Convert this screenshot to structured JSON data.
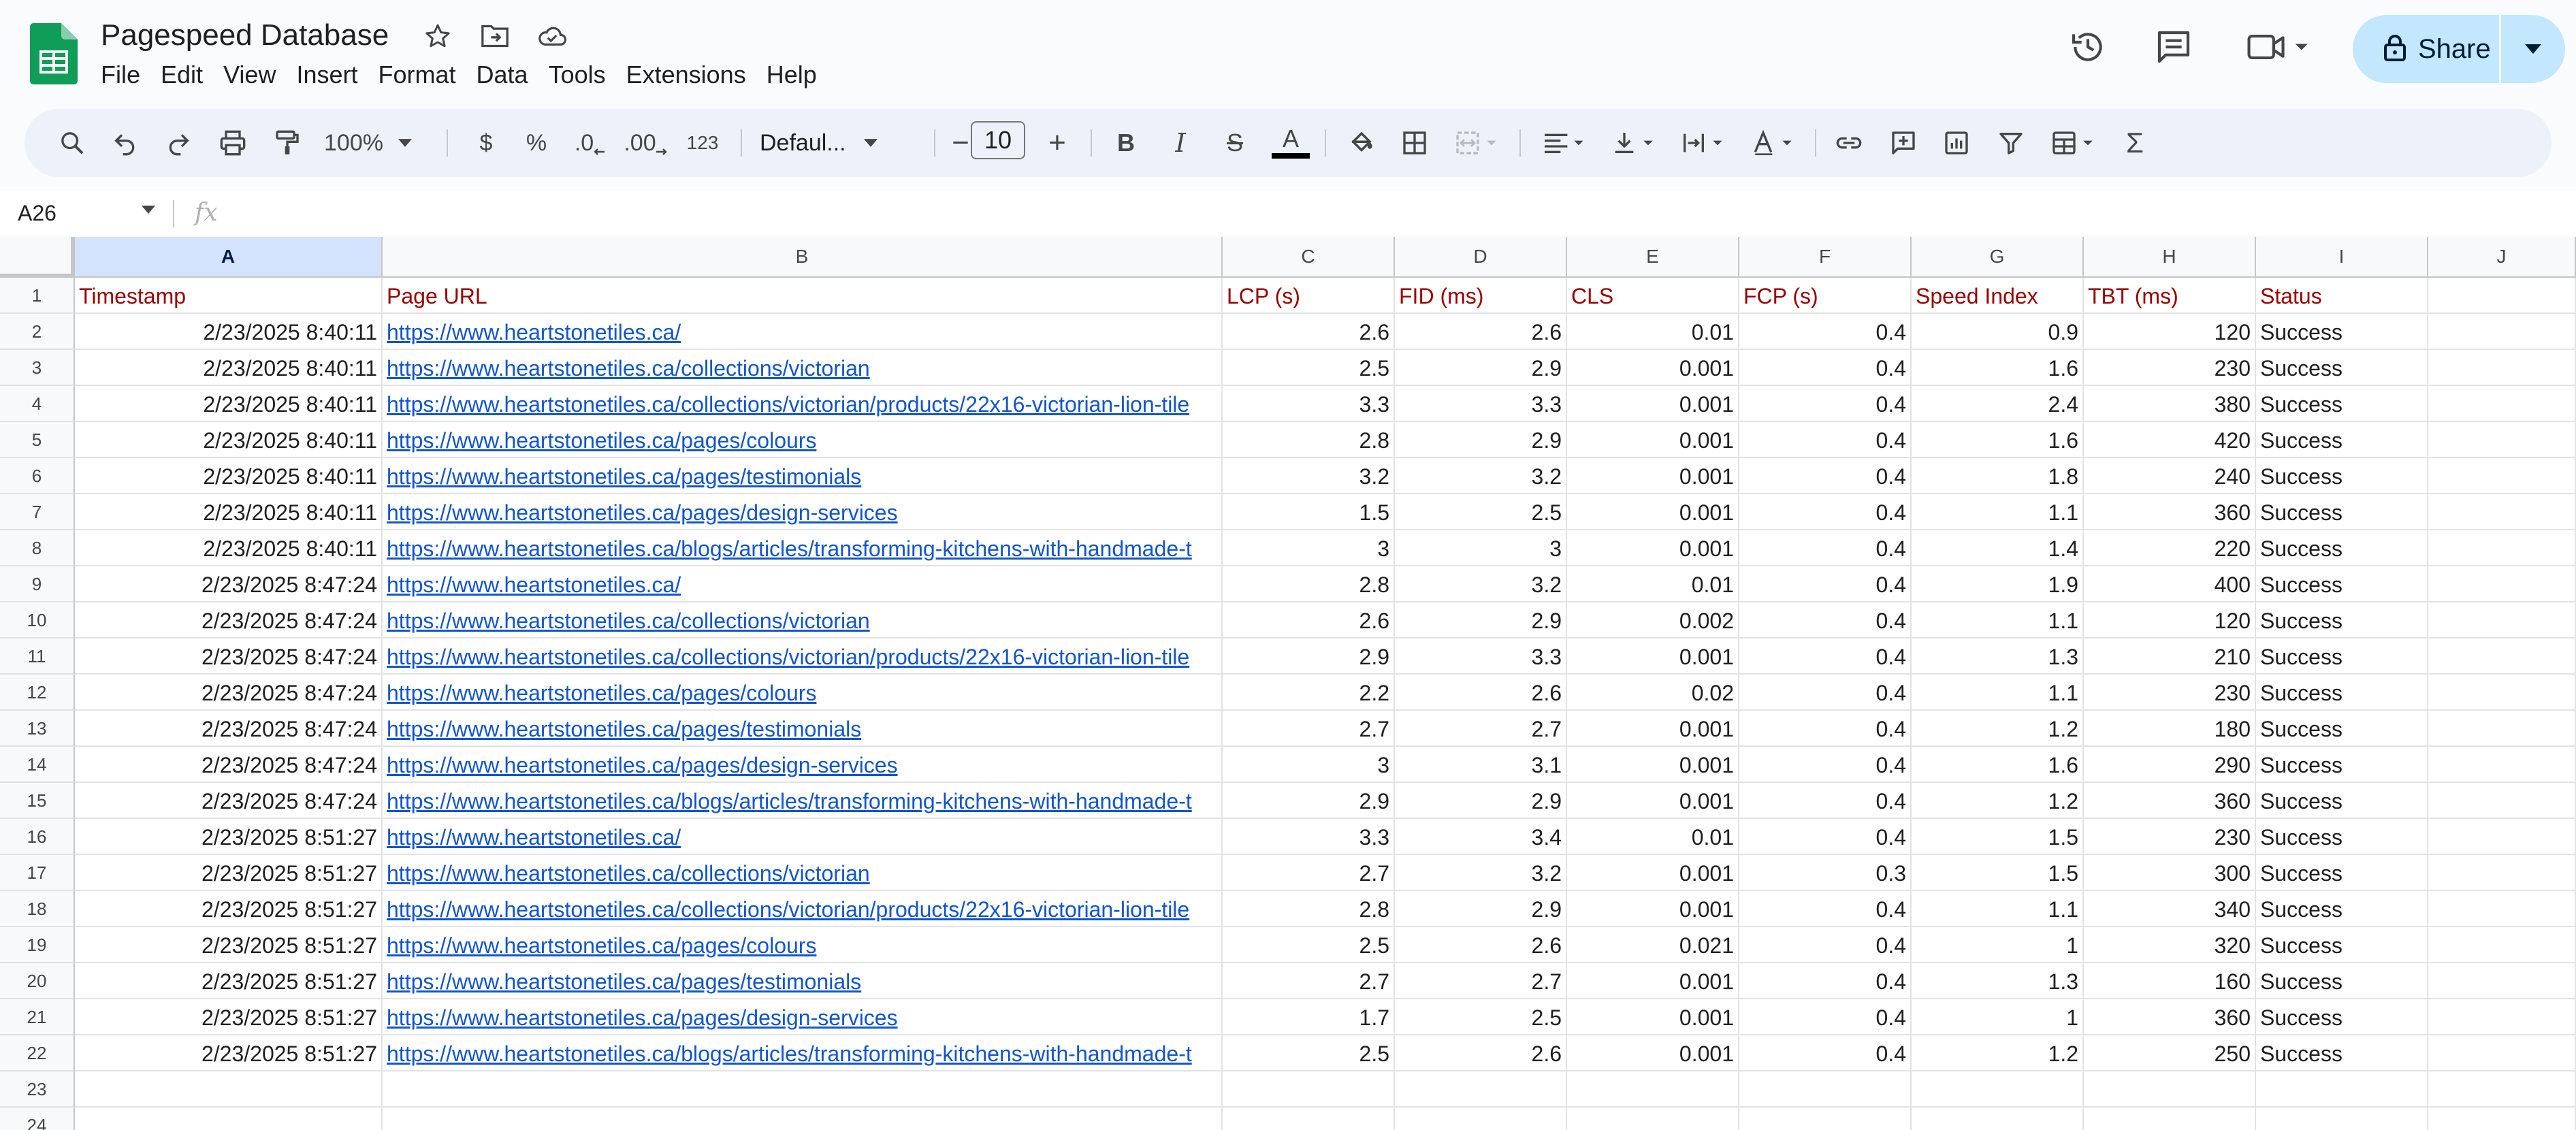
{
  "app": {
    "title": "Pagespeed Database",
    "menu": [
      "File",
      "Edit",
      "View",
      "Insert",
      "Format",
      "Data",
      "Tools",
      "Extensions",
      "Help"
    ],
    "share_label": "Share",
    "accent": "#c2e7ff"
  },
  "toolbar": {
    "zoom": "100%",
    "currency": "$",
    "percent": "%",
    "dec_decrease": ".0",
    "dec_increase": ".00",
    "number_format": "123",
    "font": "Defaul...",
    "font_size": "10",
    "minus": "−",
    "plus": "+",
    "bold": "B",
    "italic": "I",
    "strike": "S",
    "text_color": "A",
    "text_color_swatch": "#000000",
    "function": "Σ"
  },
  "formula_bar": {
    "cell_ref": "A26",
    "fx": "fx"
  },
  "columns": [
    "A",
    "B",
    "C",
    "D",
    "E",
    "F",
    "G",
    "H",
    "I",
    "J"
  ],
  "selected_column": "A",
  "row_numbers": [
    "1",
    "2",
    "3",
    "4",
    "5",
    "6",
    "7",
    "8",
    "9",
    "10",
    "11",
    "12",
    "13",
    "14",
    "15",
    "16",
    "17",
    "18",
    "19",
    "20",
    "21",
    "22",
    "23",
    "24"
  ],
  "sheet": {
    "headers": [
      "Timestamp",
      "Page URL",
      "LCP (s)",
      "FID (ms)",
      "CLS",
      "FCP (s)",
      "Speed Index",
      "TBT (ms)",
      "Status"
    ],
    "header_color": "#980000",
    "link_color": "#1155cc",
    "rows": [
      [
        "2/23/2025 8:40:11",
        "https://www.heartstonetiles.ca/",
        "2.6",
        "2.6",
        "0.01",
        "0.4",
        "0.9",
        "120",
        "Success"
      ],
      [
        "2/23/2025 8:40:11",
        "https://www.heartstonetiles.ca/collections/victorian",
        "2.5",
        "2.9",
        "0.001",
        "0.4",
        "1.6",
        "230",
        "Success"
      ],
      [
        "2/23/2025 8:40:11",
        "https://www.heartstonetiles.ca/collections/victorian/products/22x16-victorian-lion-tile",
        "3.3",
        "3.3",
        "0.001",
        "0.4",
        "2.4",
        "380",
        "Success"
      ],
      [
        "2/23/2025 8:40:11",
        "https://www.heartstonetiles.ca/pages/colours",
        "2.8",
        "2.9",
        "0.001",
        "0.4",
        "1.6",
        "420",
        "Success"
      ],
      [
        "2/23/2025 8:40:11",
        "https://www.heartstonetiles.ca/pages/testimonials",
        "3.2",
        "3.2",
        "0.001",
        "0.4",
        "1.8",
        "240",
        "Success"
      ],
      [
        "2/23/2025 8:40:11",
        "https://www.heartstonetiles.ca/pages/design-services",
        "1.5",
        "2.5",
        "0.001",
        "0.4",
        "1.1",
        "360",
        "Success"
      ],
      [
        "2/23/2025 8:40:11",
        "https://www.heartstonetiles.ca/blogs/articles/transforming-kitchens-with-handmade-t",
        "3",
        "3",
        "0.001",
        "0.4",
        "1.4",
        "220",
        "Success"
      ],
      [
        "2/23/2025 8:47:24",
        "https://www.heartstonetiles.ca/",
        "2.8",
        "3.2",
        "0.01",
        "0.4",
        "1.9",
        "400",
        "Success"
      ],
      [
        "2/23/2025 8:47:24",
        "https://www.heartstonetiles.ca/collections/victorian",
        "2.6",
        "2.9",
        "0.002",
        "0.4",
        "1.1",
        "120",
        "Success"
      ],
      [
        "2/23/2025 8:47:24",
        "https://www.heartstonetiles.ca/collections/victorian/products/22x16-victorian-lion-tile",
        "2.9",
        "3.3",
        "0.001",
        "0.4",
        "1.3",
        "210",
        "Success"
      ],
      [
        "2/23/2025 8:47:24",
        "https://www.heartstonetiles.ca/pages/colours",
        "2.2",
        "2.6",
        "0.02",
        "0.4",
        "1.1",
        "230",
        "Success"
      ],
      [
        "2/23/2025 8:47:24",
        "https://www.heartstonetiles.ca/pages/testimonials",
        "2.7",
        "2.7",
        "0.001",
        "0.4",
        "1.2",
        "180",
        "Success"
      ],
      [
        "2/23/2025 8:47:24",
        "https://www.heartstonetiles.ca/pages/design-services",
        "3",
        "3.1",
        "0.001",
        "0.4",
        "1.6",
        "290",
        "Success"
      ],
      [
        "2/23/2025 8:47:24",
        "https://www.heartstonetiles.ca/blogs/articles/transforming-kitchens-with-handmade-t",
        "2.9",
        "2.9",
        "0.001",
        "0.4",
        "1.2",
        "360",
        "Success"
      ],
      [
        "2/23/2025 8:51:27",
        "https://www.heartstonetiles.ca/",
        "3.3",
        "3.4",
        "0.01",
        "0.4",
        "1.5",
        "230",
        "Success"
      ],
      [
        "2/23/2025 8:51:27",
        "https://www.heartstonetiles.ca/collections/victorian",
        "2.7",
        "3.2",
        "0.001",
        "0.3",
        "1.5",
        "300",
        "Success"
      ],
      [
        "2/23/2025 8:51:27",
        "https://www.heartstonetiles.ca/collections/victorian/products/22x16-victorian-lion-tile",
        "2.8",
        "2.9",
        "0.001",
        "0.4",
        "1.1",
        "340",
        "Success"
      ],
      [
        "2/23/2025 8:51:27",
        "https://www.heartstonetiles.ca/pages/colours",
        "2.5",
        "2.6",
        "0.021",
        "0.4",
        "1",
        "320",
        "Success"
      ],
      [
        "2/23/2025 8:51:27",
        "https://www.heartstonetiles.ca/pages/testimonials",
        "2.7",
        "2.7",
        "0.001",
        "0.4",
        "1.3",
        "160",
        "Success"
      ],
      [
        "2/23/2025 8:51:27",
        "https://www.heartstonetiles.ca/pages/design-services",
        "1.7",
        "2.5",
        "0.001",
        "0.4",
        "1",
        "360",
        "Success"
      ],
      [
        "2/23/2025 8:51:27",
        "https://www.heartstonetiles.ca/blogs/articles/transforming-kitchens-with-handmade-t",
        "2.5",
        "2.6",
        "0.001",
        "0.4",
        "1.2",
        "250",
        "Success"
      ]
    ]
  }
}
